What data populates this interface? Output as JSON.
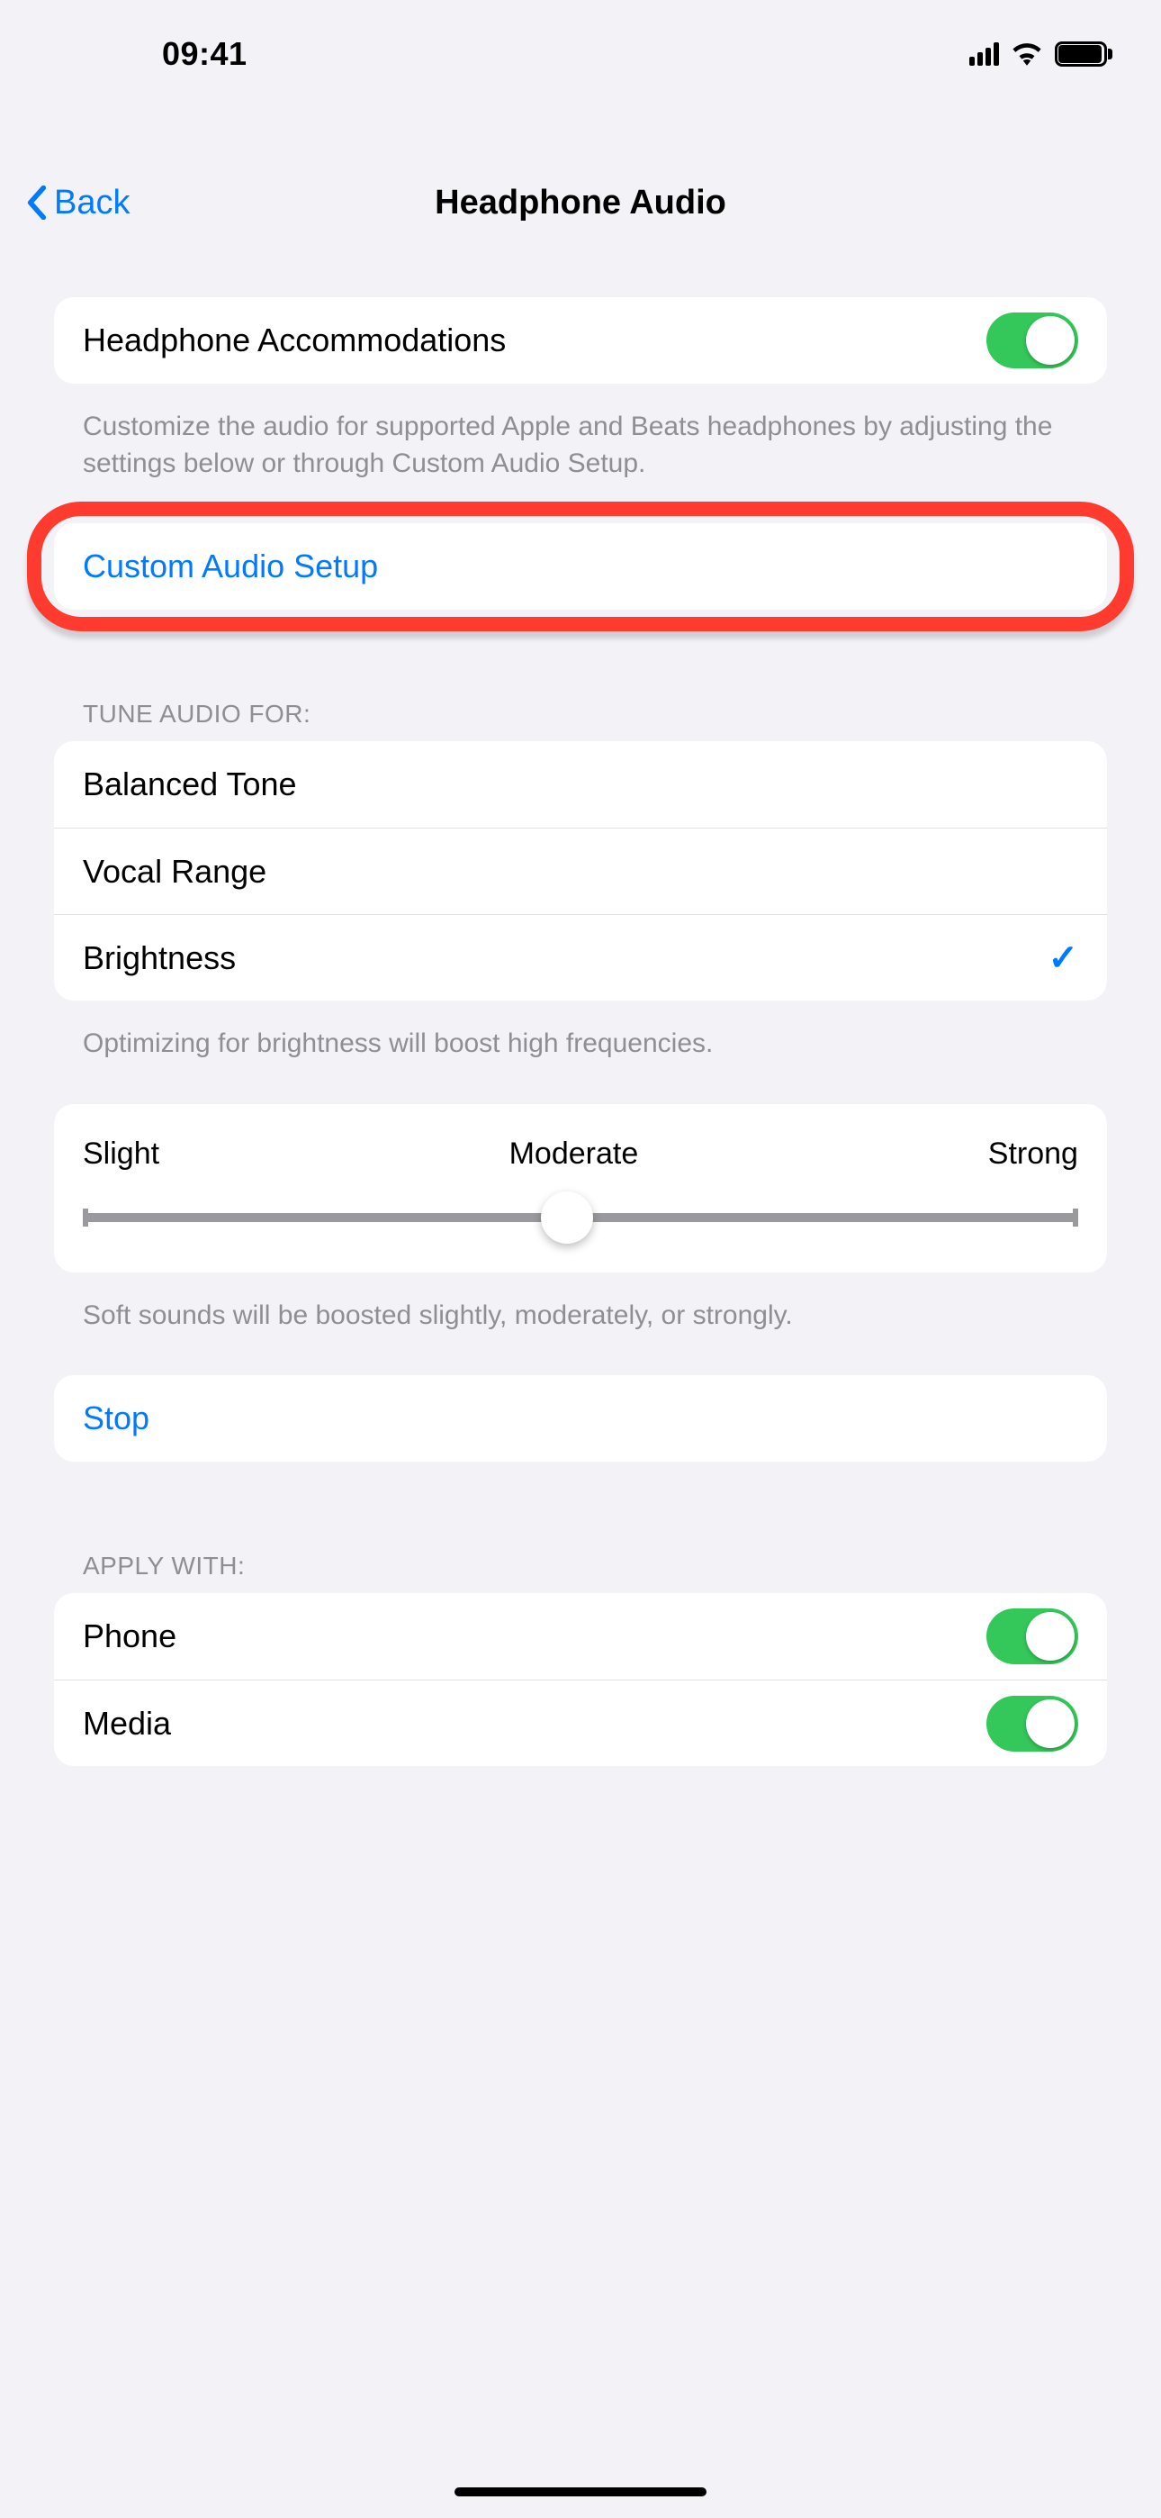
{
  "status": {
    "time": "09:41"
  },
  "nav": {
    "back": "Back",
    "title": "Headphone Audio"
  },
  "accommodations": {
    "label": "Headphone Accommodations",
    "enabled": true,
    "footer": "Customize the audio for supported Apple and Beats headphones by adjusting the settings below or through Custom Audio Setup."
  },
  "custom_setup": {
    "label": "Custom Audio Setup"
  },
  "tune": {
    "header": "Tune Audio For:",
    "options": [
      {
        "label": "Balanced Tone",
        "selected": false
      },
      {
        "label": "Vocal Range",
        "selected": false
      },
      {
        "label": "Brightness",
        "selected": true
      }
    ],
    "footer": "Optimizing for brightness will boost high frequencies."
  },
  "boost": {
    "labels": {
      "min": "Slight",
      "mid": "Moderate",
      "max": "Strong"
    },
    "value": 0.5,
    "footer": "Soft sounds will be boosted slightly, moderately, or strongly."
  },
  "stop": {
    "label": "Stop"
  },
  "apply": {
    "header": "Apply With:",
    "items": [
      {
        "label": "Phone",
        "enabled": true
      },
      {
        "label": "Media",
        "enabled": true
      }
    ]
  }
}
